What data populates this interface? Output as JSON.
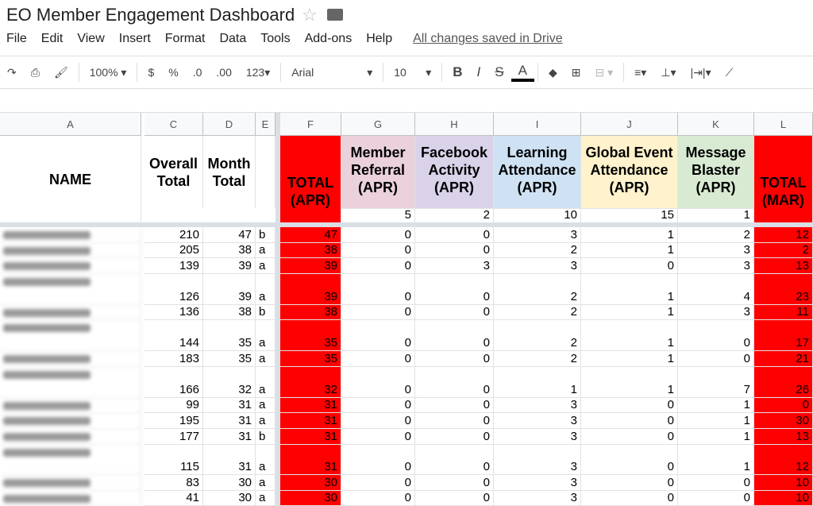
{
  "app": {
    "title": "EO Member Engagement Dashboard",
    "saved_status": "All changes saved in Drive",
    "menu": [
      "File",
      "Edit",
      "View",
      "Insert",
      "Format",
      "Data",
      "Tools",
      "Add-ons",
      "Help"
    ]
  },
  "toolbar": {
    "zoom": "100%",
    "currency": "$",
    "percent": "%",
    "dec_less": ".0",
    "dec_more": ".00",
    "format": "123",
    "font": "Arial",
    "size": "10",
    "bold": "B",
    "italic": "I",
    "strike": "S",
    "text_color": "A"
  },
  "columns": [
    "A",
    "C",
    "D",
    "E",
    "F",
    "G",
    "H",
    "I",
    "J",
    "K",
    "L"
  ],
  "header": {
    "name": "NAME",
    "overall": "Overall Total",
    "month": "Month Total",
    "total_apr": "TOTAL (APR)",
    "referral": "Member Referral (APR)",
    "facebook": "Facebook Activity (APR)",
    "learning": "Learning Attendance (APR)",
    "global": "Global Event Attendance (APR)",
    "blaster": "Message Blaster (APR)",
    "total_mar": "TOTAL (MAR)"
  },
  "weights": {
    "referral": "5",
    "facebook": "2",
    "learning": "10",
    "global": "15",
    "blaster": "1"
  },
  "colors": {
    "red": "#ff0000",
    "referral": "#ead1dc",
    "facebook": "#d9d2e9",
    "learning": "#cfe2f3",
    "global": "#fff2cc",
    "blaster": "#d9ead3"
  },
  "rows": [
    [
      "210",
      "47",
      "b",
      "47",
      "0",
      "0",
      "3",
      "1",
      "2",
      "12"
    ],
    [
      "205",
      "38",
      "a",
      "38",
      "0",
      "0",
      "2",
      "1",
      "3",
      "2"
    ],
    [
      "139",
      "39",
      "a",
      "39",
      "0",
      "3",
      "3",
      "0",
      "3",
      "13"
    ],
    [
      "126",
      "39",
      "a",
      "39",
      "0",
      "0",
      "2",
      "1",
      "4",
      "23"
    ],
    [
      "136",
      "38",
      "b",
      "38",
      "0",
      "0",
      "2",
      "1",
      "3",
      "11"
    ],
    [
      "144",
      "35",
      "a",
      "35",
      "0",
      "0",
      "2",
      "1",
      "0",
      "17"
    ],
    [
      "183",
      "35",
      "a",
      "35",
      "0",
      "0",
      "2",
      "1",
      "0",
      "21"
    ],
    [
      "166",
      "32",
      "a",
      "32",
      "0",
      "0",
      "1",
      "1",
      "7",
      "26"
    ],
    [
      "99",
      "31",
      "a",
      "31",
      "0",
      "0",
      "3",
      "0",
      "1",
      "0"
    ],
    [
      "195",
      "31",
      "a",
      "31",
      "0",
      "0",
      "3",
      "0",
      "1",
      "30"
    ],
    [
      "177",
      "31",
      "b",
      "31",
      "0",
      "0",
      "3",
      "0",
      "1",
      "13"
    ],
    [
      "115",
      "31",
      "a",
      "31",
      "0",
      "0",
      "3",
      "0",
      "1",
      "12"
    ],
    [
      "83",
      "30",
      "a",
      "30",
      "0",
      "0",
      "3",
      "0",
      "0",
      "10"
    ],
    [
      "41",
      "30",
      "a",
      "30",
      "0",
      "0",
      "3",
      "0",
      "0",
      "10"
    ]
  ]
}
